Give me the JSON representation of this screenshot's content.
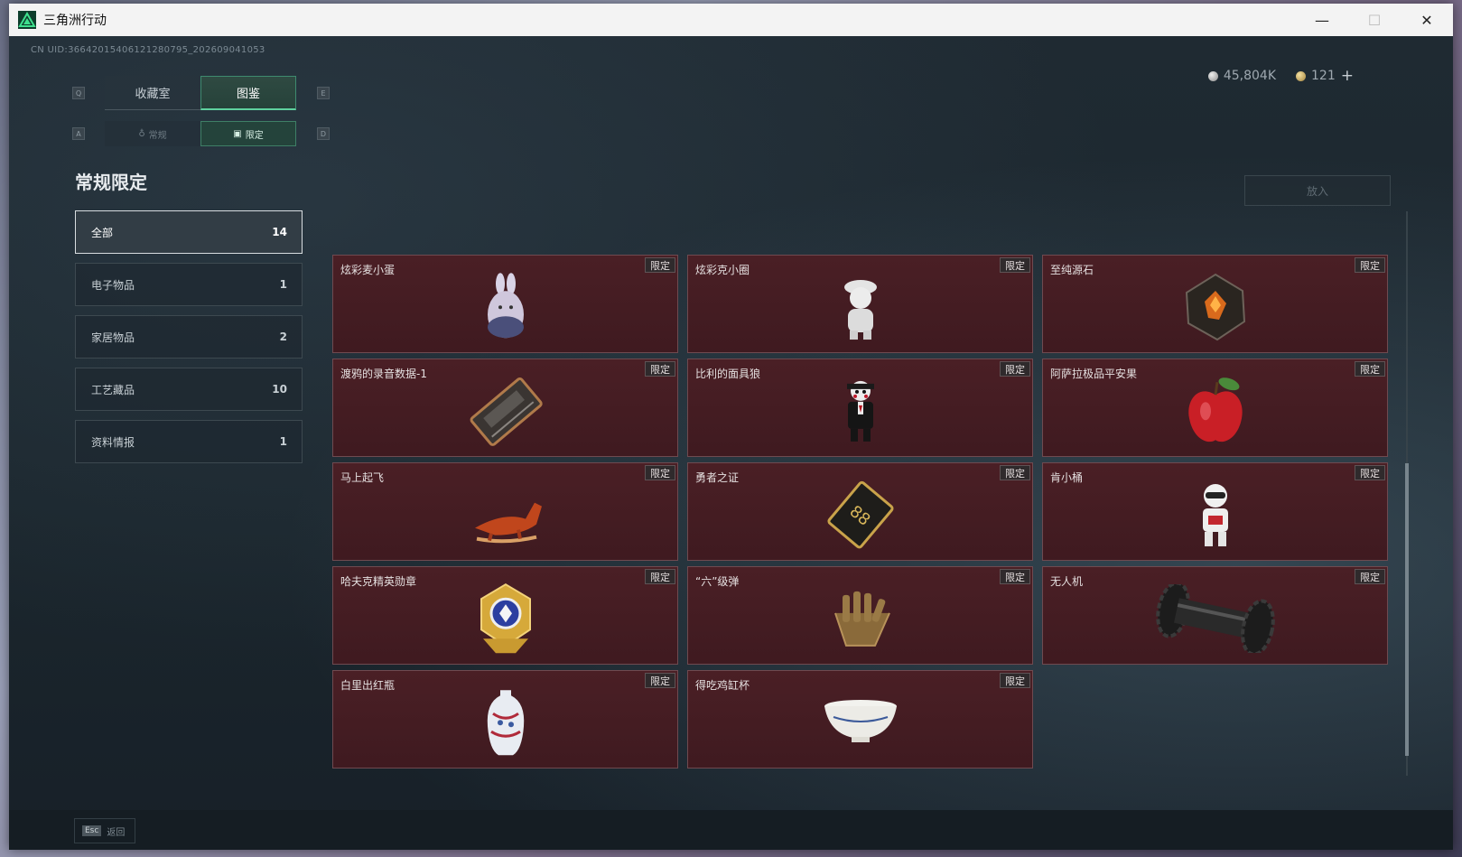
{
  "window": {
    "title": "三角洲行动",
    "minimize": "—",
    "maximize": "☐",
    "close": "✕"
  },
  "uid": "CN UID:36642015406121280795_202609041053",
  "currency": {
    "silver": "45,804K",
    "gold": "121",
    "add": "+"
  },
  "keys": {
    "q": "Q",
    "e": "E",
    "a": "A",
    "d": "D",
    "esc": "Esc"
  },
  "tabs": {
    "collection": "收藏室",
    "catalog": "图鉴"
  },
  "subtabs": {
    "regular": "常规",
    "limited": "限定"
  },
  "section_title": "常规限定",
  "categories": [
    {
      "label": "全部",
      "count": "14"
    },
    {
      "label": "电子物品",
      "count": "1"
    },
    {
      "label": "家居物品",
      "count": "2"
    },
    {
      "label": "工艺藏品",
      "count": "10"
    },
    {
      "label": "资料情报",
      "count": "1"
    }
  ],
  "put_button": "放入",
  "badge": "限定",
  "items": [
    {
      "name": "炫彩麦小蛋",
      "icon": "egg-figurine-icon"
    },
    {
      "name": "炫彩克小圈",
      "icon": "figurine-icon"
    },
    {
      "name": "至纯源石",
      "icon": "gem-icon"
    },
    {
      "name": "渡鸦的录音数据-1",
      "icon": "cassette-icon"
    },
    {
      "name": "比利的面具狼",
      "icon": "puppet-icon"
    },
    {
      "name": "阿萨拉极品平安果",
      "icon": "apple-icon"
    },
    {
      "name": "马上起飞",
      "icon": "horse-statue-icon"
    },
    {
      "name": "勇者之证",
      "icon": "card-icon"
    },
    {
      "name": "肯小桶",
      "icon": "robot-figurine-icon"
    },
    {
      "name": "哈夫克精英勋章",
      "icon": "medal-icon"
    },
    {
      "name": "“六”级弹",
      "icon": "glove-icon"
    },
    {
      "name": "无人机",
      "icon": "drone-part-icon"
    },
    {
      "name": "白里出红瓶",
      "icon": "vase-icon"
    },
    {
      "name": "得吃鸡缸杯",
      "icon": "bowl-icon"
    }
  ],
  "back_label": "返回"
}
